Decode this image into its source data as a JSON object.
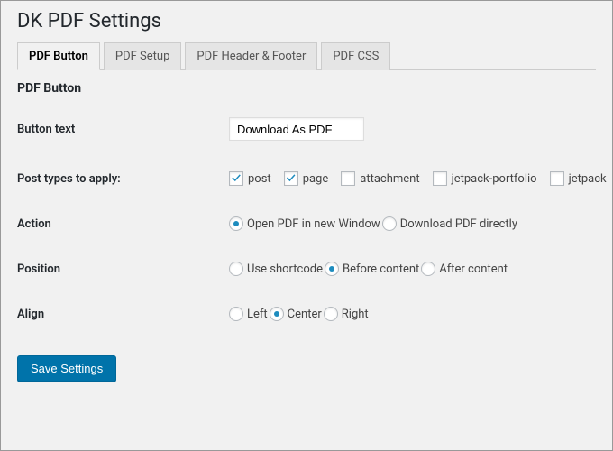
{
  "page_title": "DK PDF Settings",
  "tabs": [
    {
      "label": "PDF Button",
      "active": true
    },
    {
      "label": "PDF Setup",
      "active": false
    },
    {
      "label": "PDF Header & Footer",
      "active": false
    },
    {
      "label": "PDF CSS",
      "active": false
    }
  ],
  "section_title": "PDF Button",
  "fields": {
    "button_text": {
      "label": "Button text",
      "value": "Download As PDF"
    },
    "post_types": {
      "label": "Post types to apply:",
      "options": [
        {
          "label": "post",
          "checked": true
        },
        {
          "label": "page",
          "checked": true
        },
        {
          "label": "attachment",
          "checked": false
        },
        {
          "label": "jetpack-portfolio",
          "checked": false
        },
        {
          "label": "jetpack",
          "checked": false
        }
      ]
    },
    "action": {
      "label": "Action",
      "options": [
        {
          "label": "Open PDF in new Window",
          "selected": true
        },
        {
          "label": "Download PDF directly",
          "selected": false
        }
      ]
    },
    "position": {
      "label": "Position",
      "options": [
        {
          "label": "Use shortcode",
          "selected": false
        },
        {
          "label": "Before content",
          "selected": true
        },
        {
          "label": "After content",
          "selected": false
        }
      ]
    },
    "align": {
      "label": "Align",
      "options": [
        {
          "label": "Left",
          "selected": false
        },
        {
          "label": "Center",
          "selected": true
        },
        {
          "label": "Right",
          "selected": false
        }
      ]
    }
  },
  "save_button": "Save Settings"
}
